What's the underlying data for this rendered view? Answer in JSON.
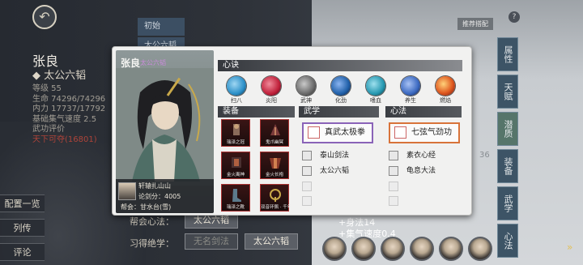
{
  "background": {
    "back_icon": "back-arrow-icon",
    "hero_name": "张良",
    "hero_title": "太公六韬",
    "stats": [
      "等级 55",
      "生命 74296/74296",
      "内力 17737/17792",
      "基础集气速度 2.5",
      "武功评价"
    ],
    "stats_red": "天下可夺(16801)",
    "side_buttons": [
      "配置一览",
      "列传",
      "评论"
    ],
    "tab_stubs": [
      "初始",
      "太公六韬"
    ],
    "rows": [
      {
        "label": "帮会心法：",
        "value": "太公六韬",
        "dim": false
      },
      {
        "label": "习得绝学：",
        "value": "无名剑法",
        "dim": true,
        "value2": "太公六韬"
      }
    ],
    "bottom_stats": [
      "+身法14",
      "+集气速度0.4"
    ],
    "right_tabs": [
      "属性",
      "天赋",
      "潜质",
      "装备",
      "武学",
      "心法"
    ],
    "recommend": "推荐搭配",
    "help": "?",
    "stat_36": "36",
    "arrow": "»"
  },
  "card": {
    "name": "张良",
    "name_sub": "太公六韬",
    "owner_line": "轩辕扎山山",
    "score_line": "论剑分：4005",
    "guild_line": "帮会：甘水台(雪)",
    "sections": {
      "xinjue": "心诀",
      "equip": "装备",
      "wuxue": "武学",
      "xinfa": "心法"
    },
    "xinjue_skills": [
      {
        "label": "扫八",
        "color": "#2a8fc8"
      },
      {
        "label": "炎阳",
        "color": "#c0203a"
      },
      {
        "label": "武神",
        "color": "#6a6a6a"
      },
      {
        "label": "化劲",
        "color": "#1f5fa8"
      },
      {
        "label": "嗜血",
        "color": "#2497b0"
      },
      {
        "label": "养生",
        "color": "#3a68c0"
      },
      {
        "label": "燃焰",
        "color": "#e05a20"
      }
    ],
    "equipment": [
      {
        "label": "瑞泽之冠",
        "color": "#6e4a3a"
      },
      {
        "label": "鬼爪幽冥",
        "color": "#5a2a2a"
      },
      {
        "label": "金火离神",
        "color": "#3a2a2a"
      },
      {
        "label": "金火长袍",
        "color": "#7a3030"
      },
      {
        "label": "瑞泽之靴",
        "color": "#3a4a5a"
      },
      {
        "label": "双音环佩 · 千年",
        "color": "#4a4a4a"
      }
    ],
    "wuxue_main": "真武太极拳",
    "wuxue_subs": [
      "泰山剑法",
      "太公六韬"
    ],
    "xinfa_main": "七弦气劲功",
    "xinfa_subs": [
      "素衣心经",
      "龟息大法"
    ]
  },
  "colors": {
    "wuxue_border": "#8a63b8",
    "xinfa_border": "#d8733a"
  }
}
